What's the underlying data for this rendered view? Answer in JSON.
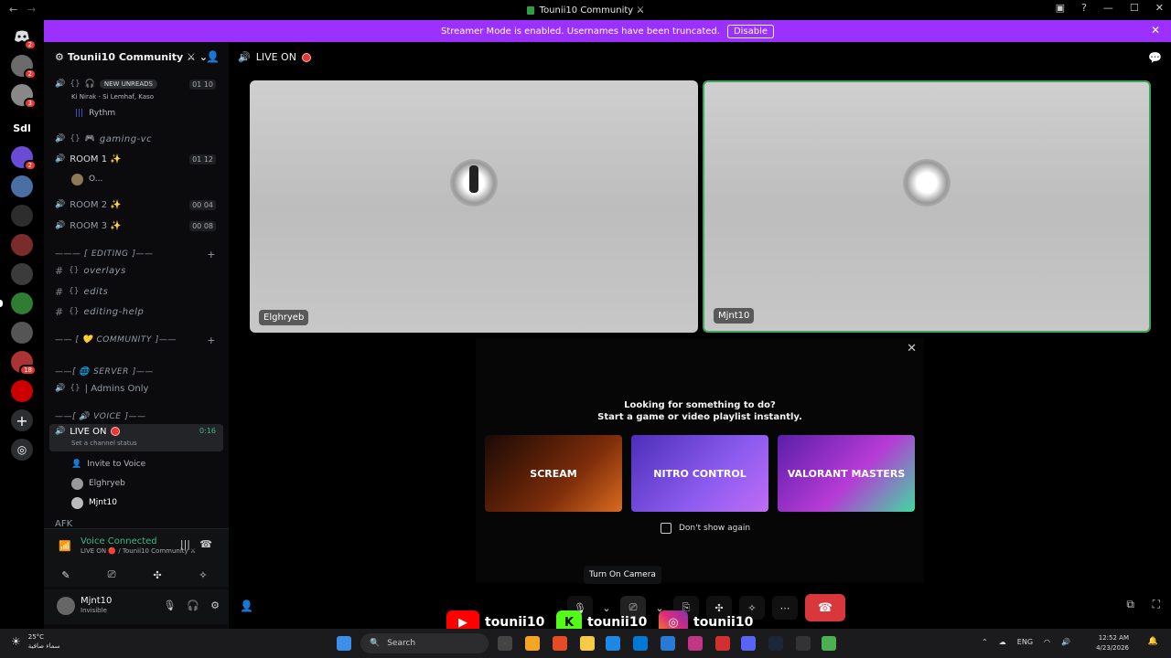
{
  "window": {
    "title": "Tounii10 Community ⚔",
    "controls": [
      "▢",
      "?",
      "—",
      "☐",
      "✕"
    ]
  },
  "banner": {
    "text": "Streamer Mode is enabled. Usernames have been truncated.",
    "disable_label": "Disable"
  },
  "guilds": [
    {
      "label": "",
      "badge": "2",
      "color": "#5865f2"
    },
    {
      "label": "",
      "badge": "2",
      "color": "#6b6b6b"
    },
    {
      "label": "",
      "badge": "3",
      "color": "#888"
    },
    {
      "label": "Sdl",
      "badge": "",
      "color": "#000"
    },
    {
      "label": "",
      "badge": "2",
      "color": "#6a4bd6"
    },
    {
      "label": "",
      "badge": "",
      "color": "#4a6fa5"
    },
    {
      "label": "",
      "badge": "",
      "color": "#2d2d2d"
    },
    {
      "label": "",
      "badge": "",
      "color": "#7a2b2b"
    },
    {
      "label": "",
      "badge": "",
      "color": "#3b3b3b"
    },
    {
      "label": "",
      "badge": "",
      "color": "#2f7d32"
    },
    {
      "label": "",
      "badge": "",
      "color": "#555"
    },
    {
      "label": "",
      "badge": "18",
      "color": "#a33"
    },
    {
      "label": "",
      "badge": "",
      "color": "#c00"
    }
  ],
  "sidebar": {
    "server_name": "Tounii10 Community ⚔",
    "new_unreads": "NEW UNREADS",
    "unreads_users": "Ki Nirak - Si Lemhaf, Kaso",
    "rythm": "Rythm",
    "channels": [
      {
        "name": "gaming-vc",
        "type": "voice",
        "count": ""
      },
      {
        "name": "ROOM 1 ✨",
        "type": "voice",
        "count": "01 12"
      },
      {
        "name": "ROOM 2 ✨",
        "type": "voice",
        "count": "00 04"
      },
      {
        "name": "ROOM 3 ✨",
        "type": "voice",
        "count": "00 08"
      }
    ],
    "room1_user": "O...",
    "top_counts": "01 10",
    "cat_editing": "EDITING",
    "text_channels": [
      "overlays",
      "edits",
      "editing-help"
    ],
    "cat_community": "COMMUNITY",
    "cat_server": "SERVER",
    "admins_only": "| Admins Only",
    "cat_voice": "VOICE",
    "live_on": "LIVE ON",
    "live_time": "0:16",
    "channel_status": "Set a channel status",
    "invite": "Invite to Voice",
    "members": [
      "Elghryeb",
      "Mjnt10"
    ],
    "afk": "AFK"
  },
  "voice_panel": {
    "title": "Voice Connected",
    "subtitle": "LIVE ON 🔴 / Tounii10 Community ⚔"
  },
  "user_panel": {
    "name": "Mjnt10",
    "status": "Invisible"
  },
  "stage": {
    "header": "LIVE ON",
    "tiles": [
      {
        "name": "Elghryeb"
      },
      {
        "name": "Mjnt10"
      }
    ]
  },
  "activity": {
    "line1": "Looking for something to do?",
    "line2": "Start a game or video playlist instantly.",
    "cards": [
      "SCREAM",
      "NITRO CONTROL",
      "VALORANT MASTERS"
    ],
    "dont_show": "Don't show again"
  },
  "tooltip": "Turn On Camera",
  "overlay": {
    "handles": [
      "tounii10",
      "tounii10",
      "tounii10"
    ]
  },
  "taskbar": {
    "weather_temp": "25°C",
    "weather_desc": "سماء صافية",
    "search_placeholder": "Search",
    "lang": "ENG",
    "time": "12:52 AM",
    "date": "4/23/2026"
  }
}
